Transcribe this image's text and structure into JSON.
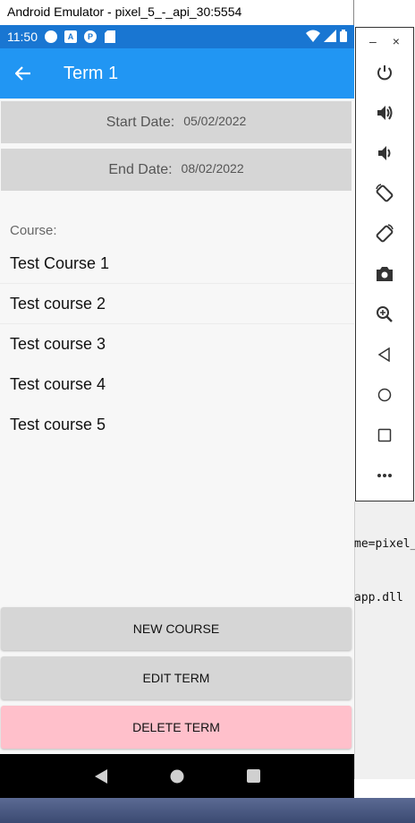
{
  "window": {
    "title": "Android Emulator - pixel_5_-_api_30:5554"
  },
  "statusbar": {
    "time": "11:50",
    "icons": [
      "circle-icon",
      "a-icon",
      "p-icon",
      "sd-card-icon"
    ],
    "right_icons": [
      "wifi-icon",
      "signal-icon",
      "battery-icon"
    ]
  },
  "appbar": {
    "title": "Term 1",
    "back_icon": "arrow-back-icon"
  },
  "dates": {
    "start_label": "Start Date:",
    "start_value": "05/02/2022",
    "end_label": "End Date:",
    "end_value": "08/02/2022"
  },
  "course_label": "Course:",
  "courses": [
    "Test Course 1",
    "Test course 2",
    "Test course 3",
    "Test course 4",
    "Test course 5"
  ],
  "buttons": {
    "new_course": "NEW COURSE",
    "edit_term": "EDIT TERM",
    "delete_term": "DELETE TERM"
  },
  "colors": {
    "statusbar": "#1976d2",
    "appbar": "#2196f3",
    "button_gray": "#d6d6d6",
    "button_delete": "#ffc0cb"
  },
  "navbar": {
    "icons": [
      "back-triangle-icon",
      "home-circle-icon",
      "recents-square-icon"
    ]
  },
  "toolbar": {
    "minimize": "–",
    "close": "×",
    "icons": [
      "power-icon",
      "volume-up-icon",
      "volume-down-icon",
      "rotate-left-icon",
      "rotate-right-icon",
      "camera-icon",
      "zoom-icon",
      "back-icon",
      "home-icon",
      "overview-icon",
      "more-icon"
    ]
  },
  "console": {
    "line1": "me=pixel_",
    "line2": "app.dll"
  }
}
